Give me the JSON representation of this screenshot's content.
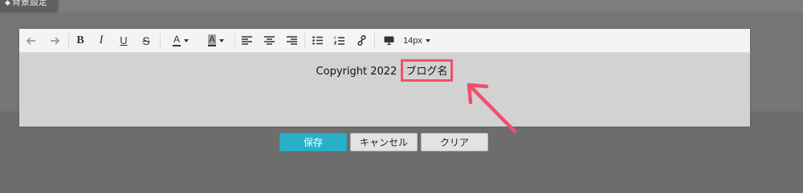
{
  "background_tab": {
    "label": "背景設定"
  },
  "toolbar": {
    "undo_icon": "undo-arrow-icon",
    "redo_icon": "redo-arrow-icon",
    "bold": "B",
    "italic": "I",
    "underline": "U",
    "strikethrough": "S",
    "font_color": "A",
    "highlight_color": "A",
    "font_size": "14px"
  },
  "editor": {
    "text": "Copyright 2022",
    "highlighted_text": "ブログ名"
  },
  "annotation": {
    "arrow_color": "#f0506e"
  },
  "buttons": {
    "save": "保存",
    "cancel": "キャンセル",
    "clear": "クリア"
  },
  "colors": {
    "save_button": "#29b0c9",
    "editor_bg": "#d2d2d2",
    "overlay_bg": "#767676"
  }
}
